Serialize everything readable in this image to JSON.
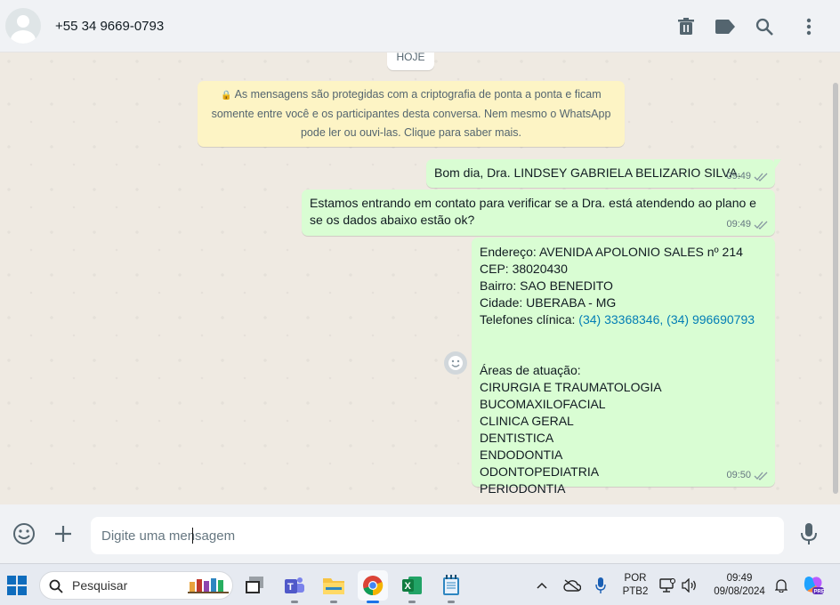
{
  "header": {
    "contact_name": "+55 34 9669-0793"
  },
  "chat": {
    "date_chip": "HOJE",
    "encryption_notice": {
      "line1": "As mensagens são protegidas com a criptografia de ponta a ponta e ficam",
      "line2": "somente entre você e os participantes desta conversa. Nem mesmo o WhatsApp",
      "line3": "pode ler ou ouvi-las. Clique para saber mais."
    },
    "messages": [
      {
        "text": "Bom dia, Dra.  LINDSEY GABRIELA BELIZARIO SILVA.",
        "time": "09:49"
      },
      {
        "line1": "Estamos entrando em contato para verificar se a Dra. está atendendo ao plano e",
        "line2": "se os dados abaixo estão ok?",
        "time": "09:49"
      },
      {
        "endereco": "Endereço: AVENIDA APOLONIO SALES nº 214",
        "cep": "CEP: 38020430",
        "bairro": "Bairro: SAO BENEDITO",
        "cidade": "Cidade: UBERABA - MG",
        "telefones_label": "Telefones clínica: ",
        "telefones_links": "(34) 33368346, (34) 996690793",
        "areas_label": "Áreas de atuação:",
        "areas": [
          "CIRURGIA E TRAUMATOLOGIA BUCOMAXILOFACIAL",
          "CLINICA GERAL",
          "DENTISTICA",
          "ENDODONTIA",
          "ODONTOPEDIATRIA",
          "PERIODONTIA"
        ],
        "time": "09:50"
      }
    ]
  },
  "composer": {
    "placeholder": "Digite uma mensagem"
  },
  "taskbar": {
    "search_label": "Pesquisar",
    "lang_top": "POR",
    "lang_bottom": "PTB2",
    "clock_time": "09:49",
    "clock_date": "09/08/2024"
  },
  "colors": {
    "bubble_out": "#d9fdd3",
    "notice_bg": "#fdf4c5",
    "link": "#027eb5",
    "tick": "#8696a0"
  }
}
